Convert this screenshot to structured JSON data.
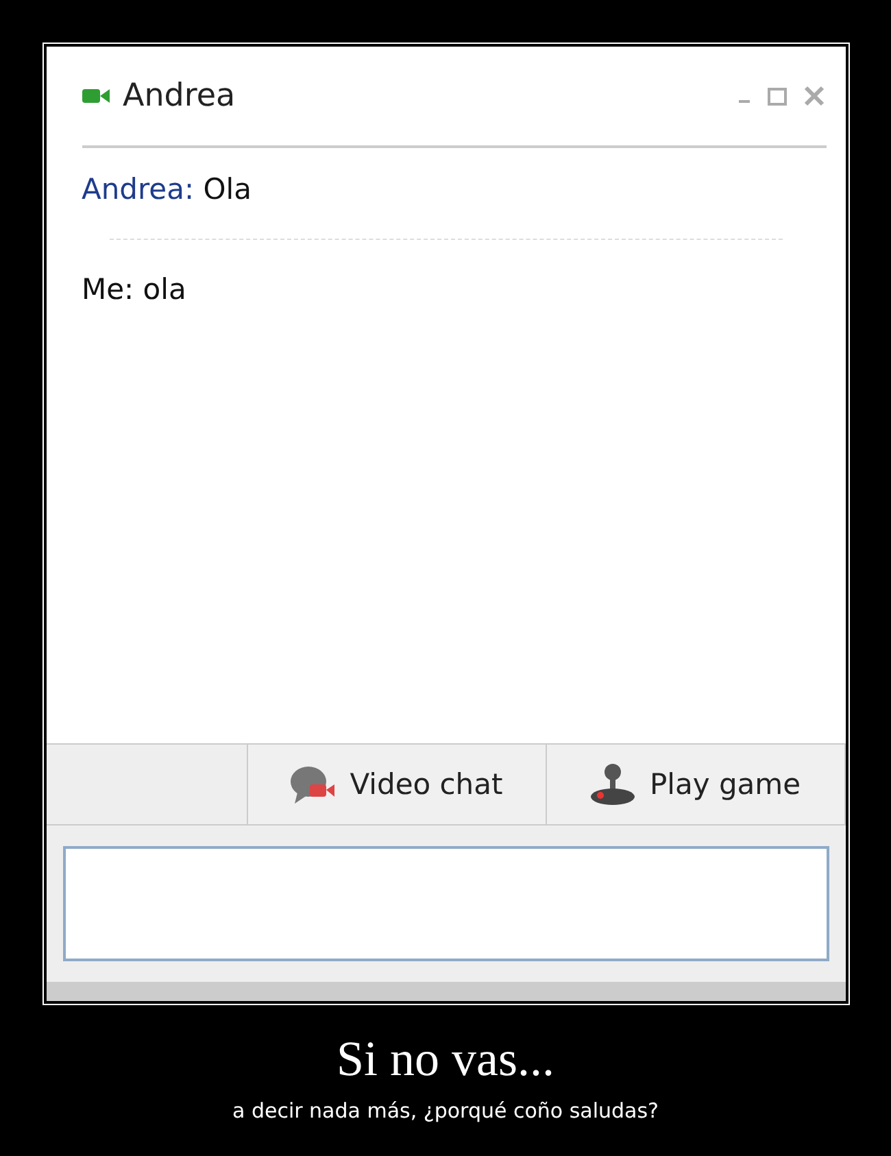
{
  "window": {
    "title": "Andrea"
  },
  "messages": [
    {
      "sender": "Andrea:",
      "text": "Ola",
      "kind": "contact"
    },
    {
      "sender": "Me:",
      "text": "ola",
      "kind": "self"
    }
  ],
  "toolbar": [
    {
      "label": "Video chat",
      "kind": "video"
    },
    {
      "label": "Play game",
      "kind": "game"
    }
  ],
  "caption": {
    "title": "Si no vas...",
    "subtitle": "a decir nada más, ¿porqué coño saludas?"
  }
}
